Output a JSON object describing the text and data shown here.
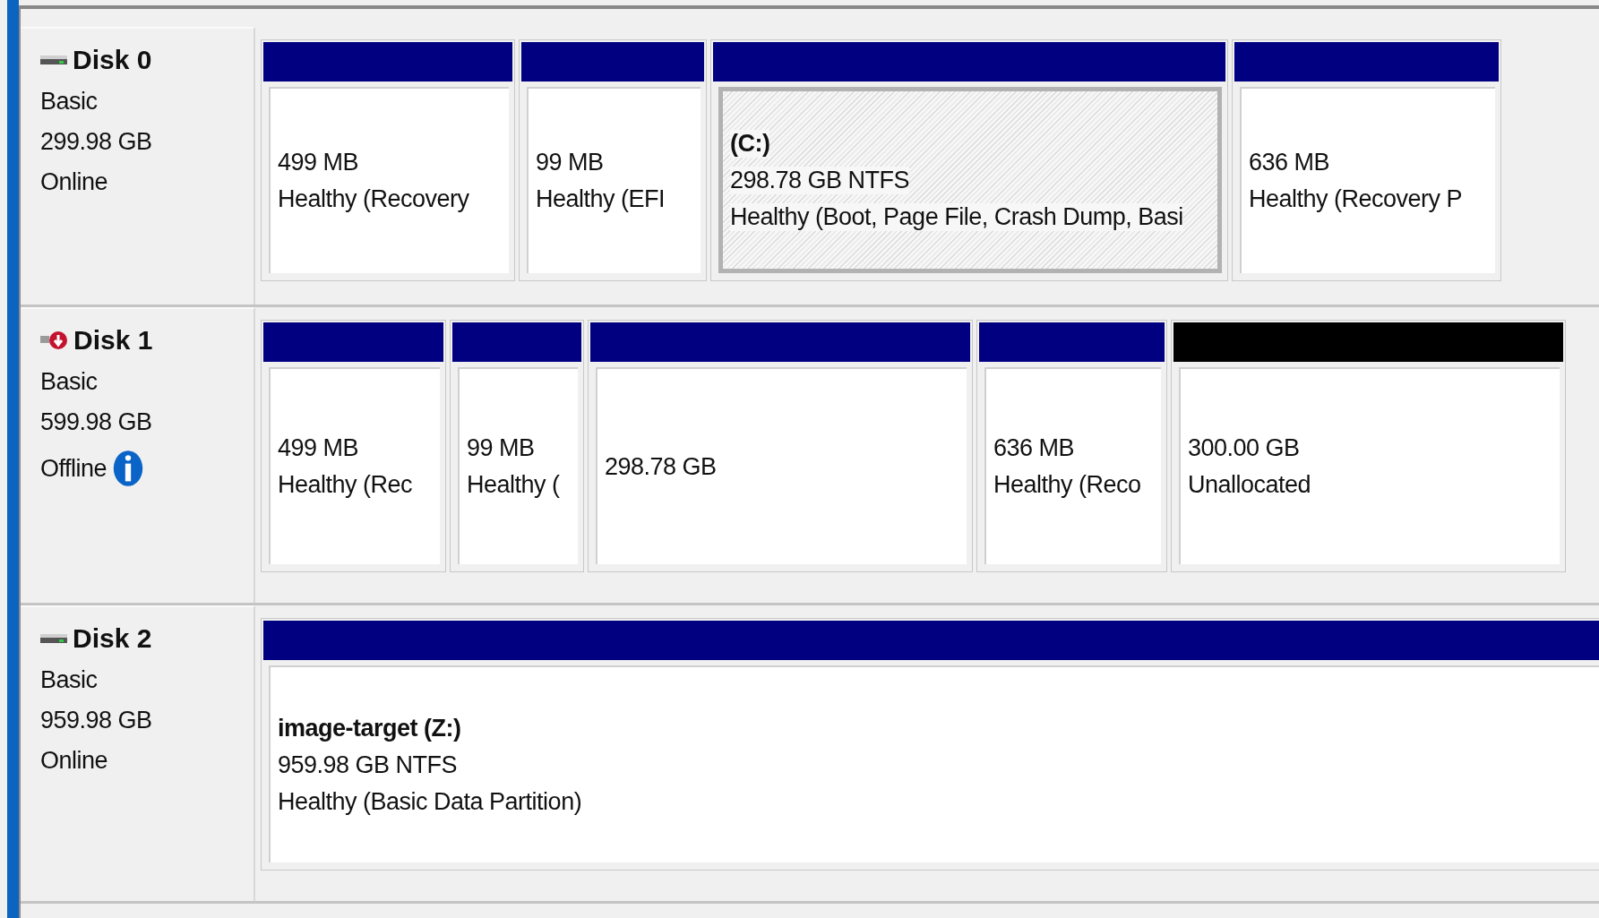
{
  "disks": [
    {
      "name": "Disk 0",
      "offline": false,
      "type": "Basic",
      "size": "299.98 GB",
      "status": "Online",
      "info": false,
      "partitions": [
        {
          "kind": "primary",
          "selected": false,
          "size": "499 MB",
          "status": "Healthy (Recovery"
        },
        {
          "kind": "primary",
          "selected": false,
          "size": "99 MB",
          "status": "Healthy (EFI"
        },
        {
          "kind": "primary",
          "selected": true,
          "label": "(C:)",
          "size": "298.78 GB NTFS",
          "status": "Healthy (Boot, Page File, Crash Dump, Basi"
        },
        {
          "kind": "primary",
          "selected": false,
          "size": "636 MB",
          "status": "Healthy (Recovery P"
        }
      ]
    },
    {
      "name": "Disk 1",
      "offline": true,
      "type": "Basic",
      "size": "599.98 GB",
      "status": "Offline",
      "info": true,
      "partitions": [
        {
          "kind": "primary",
          "selected": false,
          "size": "499 MB",
          "status": "Healthy (Rec"
        },
        {
          "kind": "primary",
          "selected": false,
          "size": "99 MB",
          "status": "Healthy ("
        },
        {
          "kind": "primary",
          "selected": false,
          "size": "298.78 GB"
        },
        {
          "kind": "primary",
          "selected": false,
          "size": "636 MB",
          "status": "Healthy (Reco"
        },
        {
          "kind": "unallocated",
          "selected": false,
          "size": "300.00 GB",
          "status": "Unallocated"
        }
      ]
    },
    {
      "name": "Disk 2",
      "offline": false,
      "type": "Basic",
      "size": "959.98 GB",
      "status": "Online",
      "info": false,
      "partitions": [
        {
          "kind": "primary",
          "selected": false,
          "label": "image-target  (Z:)",
          "size": "959.98 GB NTFS",
          "status": "Healthy (Basic Data Partition)"
        }
      ]
    }
  ]
}
